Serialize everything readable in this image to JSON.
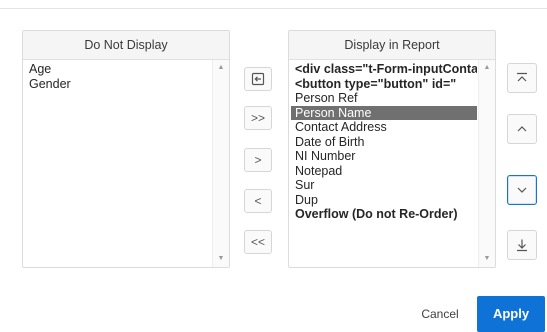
{
  "left_panel": {
    "title": "Do Not Display",
    "items": [
      "Age",
      "Gender"
    ]
  },
  "right_panel": {
    "title": "Display in Report",
    "items": [
      {
        "text": "<div class=\"t-Form-inputContainer\">",
        "bold": true
      },
      {
        "text": "<button type=\"button\" id=\"",
        "bold": true
      },
      {
        "text": "Person Ref"
      },
      {
        "text": "Person Name",
        "selected": true
      },
      {
        "text": "Contact Address"
      },
      {
        "text": "Date of Birth"
      },
      {
        "text": "NI Number"
      },
      {
        "text": "Notepad"
      },
      {
        "text": "Sur"
      },
      {
        "text": "Dup"
      },
      {
        "text": "Overflow (Do not Re-Order)",
        "bold": true
      }
    ]
  },
  "transfer_buttons": {
    "reset": "reset-icon",
    "move_all_right": ">>",
    "move_right": ">",
    "move_left": "<",
    "move_all_left": "<<"
  },
  "order_buttons": {
    "top": "move-top-icon",
    "up": "move-up-icon",
    "down": "move-down-icon",
    "bottom": "move-bottom-icon"
  },
  "footer": {
    "cancel_label": "Cancel",
    "apply_label": "Apply"
  },
  "colors": {
    "accent": "#0e72d6",
    "selected_row": "#707070",
    "focus_border": "#1a73c8"
  }
}
